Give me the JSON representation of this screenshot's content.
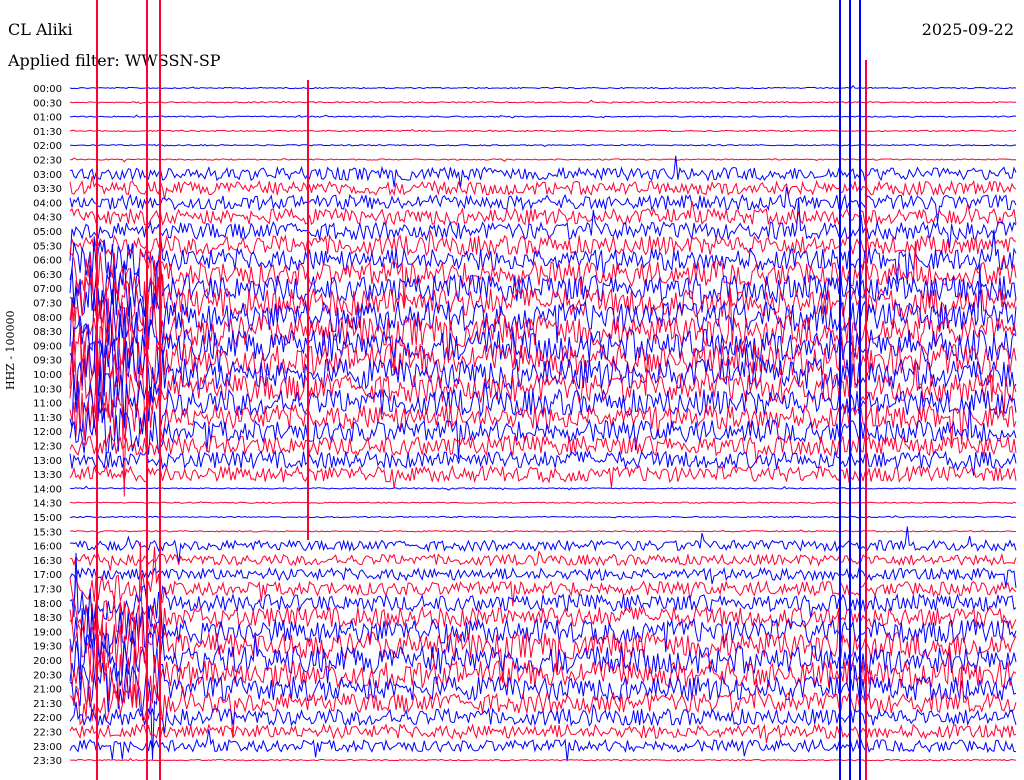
{
  "header": {
    "station": "CL Aliki",
    "date": "2025-09-22",
    "filter": "Applied filter: WWSSN-SP"
  },
  "chart_data": {
    "type": "line",
    "title": "CL Aliki",
    "ylabel": "HHZ - 100000",
    "filter": "WWSSN-SP",
    "date": "2025-09-22",
    "row_labels": [
      "00:00",
      "00:30",
      "01:00",
      "01:30",
      "02:00",
      "02:30",
      "03:00",
      "03:30",
      "04:00",
      "04:30",
      "05:00",
      "05:30",
      "06:00",
      "06:30",
      "07:00",
      "07:30",
      "08:00",
      "08:30",
      "09:00",
      "09:30",
      "10:00",
      "10:30",
      "11:00",
      "11:30",
      "12:00",
      "12:30",
      "13:00",
      "13:30",
      "14:00",
      "14:30",
      "15:00",
      "15:30",
      "16:00",
      "16:30",
      "17:00",
      "17:30",
      "18:00",
      "18:30",
      "19:00",
      "19:30",
      "20:00",
      "20:30",
      "21:00",
      "21:30",
      "22:00",
      "22:30",
      "23:00",
      "23:30"
    ],
    "row_colors": [
      "#0000ff",
      "#ff0033"
    ],
    "dominant_activity_rows": [
      "03:00-13:30",
      "16:00-23:00"
    ],
    "notable_events": [
      {
        "time": "11:00",
        "note": "high amplitude spikes"
      },
      {
        "time": "23:30",
        "note": "narrow trace at end"
      }
    ]
  }
}
